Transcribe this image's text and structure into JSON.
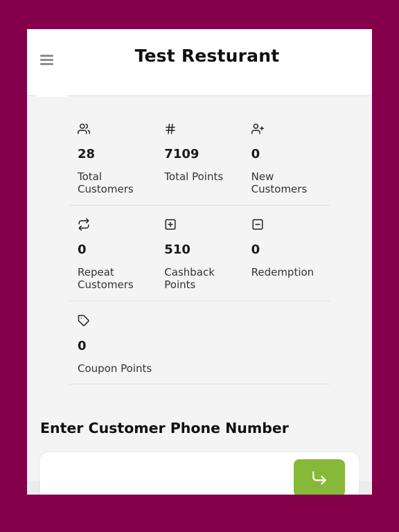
{
  "header": {
    "title": "Test Resturant"
  },
  "stats": [
    {
      "icon": "users-icon",
      "value": "28",
      "label": "Total Customers"
    },
    {
      "icon": "hash-icon",
      "value": "7109",
      "label": "Total Points"
    },
    {
      "icon": "user-plus-icon",
      "value": "0",
      "label": "New Customers"
    },
    {
      "icon": "repeat-icon",
      "value": "0",
      "label": "Repeat Customers"
    },
    {
      "icon": "plus-square-icon",
      "value": "510",
      "label": "Cashback Points"
    },
    {
      "icon": "minus-square-icon",
      "value": "0",
      "label": "Redemption"
    },
    {
      "icon": "tag-icon",
      "value": "0",
      "label": "Coupon Points"
    }
  ],
  "phone_section": {
    "title": "Enter Customer Phone Number",
    "input_value": "",
    "submit_icon": "corner-down-right-icon"
  },
  "colors": {
    "background": "#85004b",
    "accent_button": "#86b83a",
    "panel": "#f4f4f4"
  }
}
